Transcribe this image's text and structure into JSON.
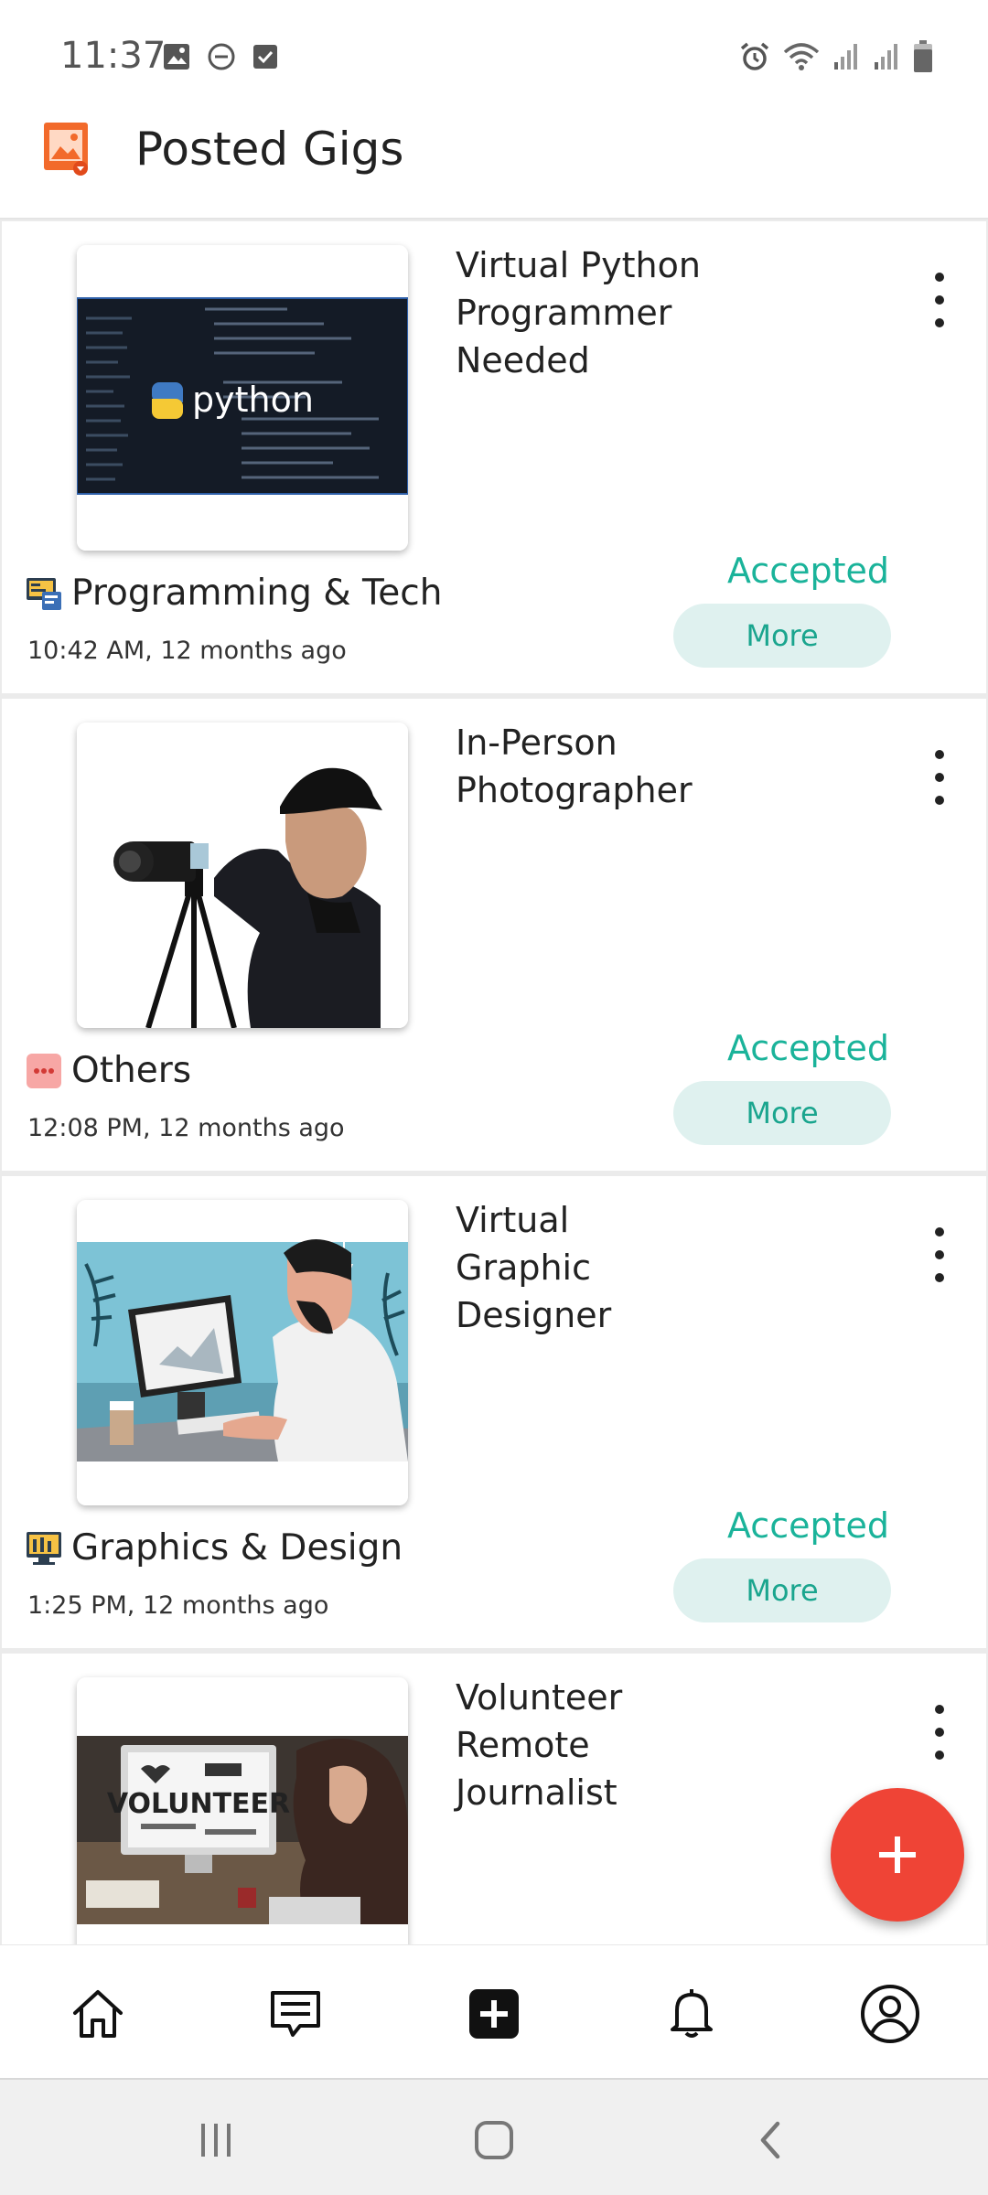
{
  "status_bar": {
    "time": "11:37",
    "left_icons": [
      "gallery-icon",
      "do-not-disturb-icon",
      "checkbox-icon"
    ],
    "right_icons": [
      "alarm-icon",
      "wifi-icon",
      "signal-icon",
      "signal-icon",
      "battery-icon"
    ]
  },
  "app_bar": {
    "title": "Posted Gigs",
    "logo_icon": "gig-logo-icon"
  },
  "gigs": [
    {
      "title": "Virtual Python Programmer Needed",
      "category": "Programming & Tech",
      "category_icon": "programming-icon",
      "time": "10:42 AM, 12 months ago",
      "status": "Accepted",
      "more_label": "More",
      "image": "python-code-thumbnail",
      "image_text": "python"
    },
    {
      "title": "In-Person Photographer",
      "category": "Others",
      "category_icon": "others-icon",
      "time": "12:08 PM, 12 months ago",
      "status": "Accepted",
      "more_label": "More",
      "image": "photographer-thumbnail"
    },
    {
      "title": "Virtual Graphic Designer",
      "category": "Graphics & Design",
      "category_icon": "graphics-icon",
      "time": "1:25 PM, 12 months ago",
      "status": "Accepted",
      "more_label": "More",
      "image": "designer-thumbnail"
    },
    {
      "title": "Volunteer Remote Journalist",
      "image": "volunteer-thumbnail",
      "image_text": "VOLUNTEER"
    }
  ],
  "fab": {
    "icon": "plus-icon"
  },
  "bottom_nav": [
    "home-icon",
    "messages-icon",
    "add-gig-icon",
    "notifications-icon",
    "profile-icon"
  ],
  "system_nav": [
    "recent-apps-icon",
    "home-button-icon",
    "back-icon"
  ],
  "colors": {
    "accent_green": "#1ab39a",
    "more_bg": "#dff1ef",
    "fab_red": "#ef4436",
    "logo_orange": "#f26a2b"
  }
}
